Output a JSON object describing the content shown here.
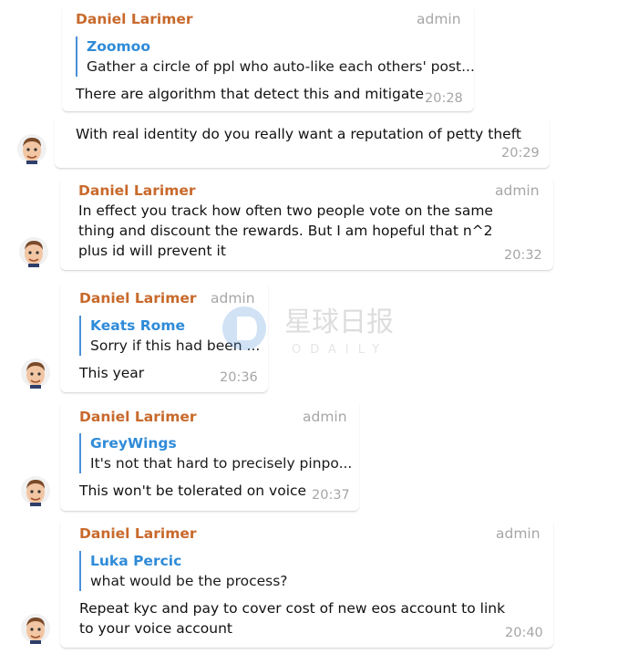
{
  "messages": [
    {
      "author": "Daniel Larimer",
      "role": "admin",
      "quote": {
        "name": "Zoomoo",
        "text": "Gather a circle of ppl who auto-like each others' post..."
      },
      "text": "There are algorithm that detect this and mitigate",
      "time": "20:28"
    },
    {
      "text": "With real identity do you really want a reputation of petty theft",
      "time": "20:29"
    },
    {
      "author": "Daniel Larimer",
      "role": "admin",
      "text": "In effect you track how often two people vote on the same thing and discount the rewards.  But I am hopeful that n^2 plus id will prevent it",
      "time": "20:32"
    },
    {
      "author": "Daniel Larimer",
      "role": "admin",
      "quote": {
        "name": "Keats Rome",
        "text": "Sorry if this had been ..."
      },
      "text": "This year",
      "time": "20:36"
    },
    {
      "author": "Daniel Larimer",
      "role": "admin",
      "quote": {
        "name": "GreyWings",
        "text": "It's not that hard to precisely pinpo..."
      },
      "text": "This won't be tolerated on voice",
      "time": "20:37"
    },
    {
      "author": "Daniel Larimer",
      "role": "admin",
      "quote": {
        "name": "Luka Percic",
        "text": "what would be the process?"
      },
      "text": "Repeat kyc and pay to cover cost of new eos account to link to your voice account",
      "time": "20:40"
    }
  ],
  "watermark": {
    "title": "星球日报",
    "subtitle": "ODAILY"
  },
  "colors": {
    "author": "#c8692b",
    "quote_name": "#2f8bd8",
    "quote_bar": "#4a90d9",
    "meta": "#a6a6a6"
  },
  "icons": {
    "avatar": "user-avatar-icon"
  }
}
